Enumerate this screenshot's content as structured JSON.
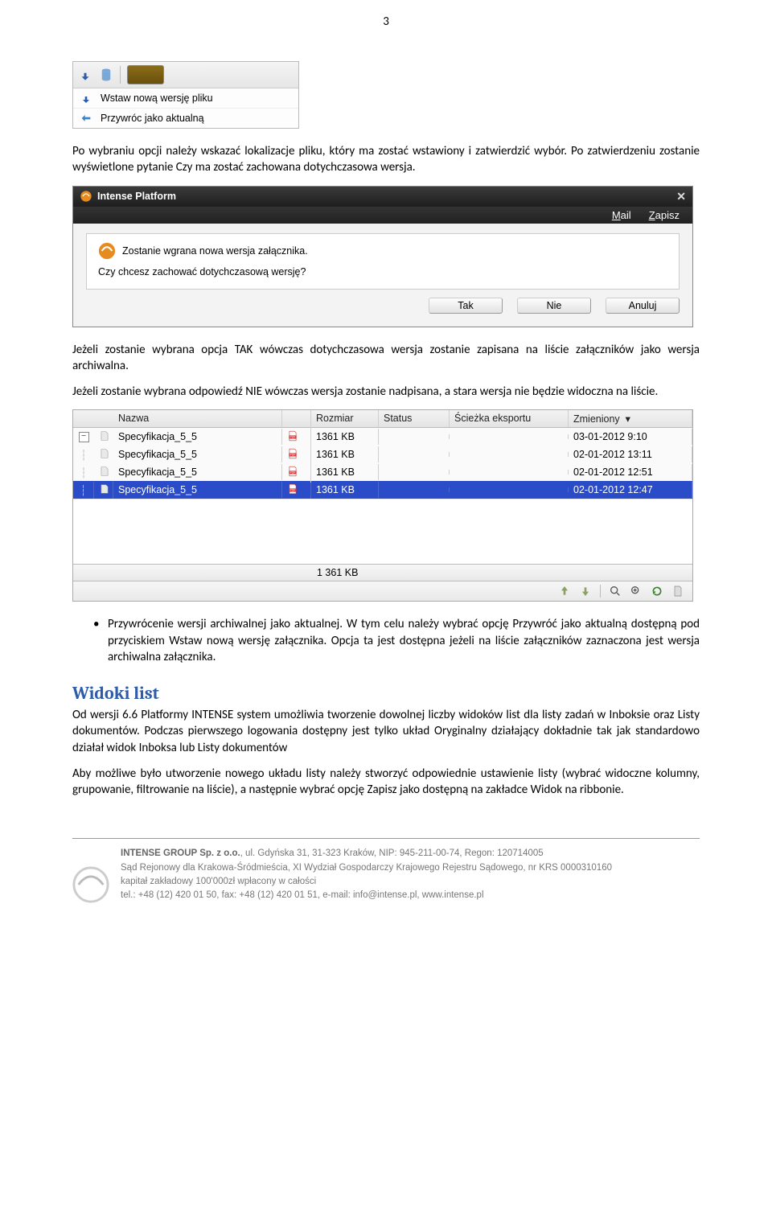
{
  "page_number": "3",
  "menu_shot": {
    "item1": "Wstaw nową wersję pliku",
    "item2": "Przywróc jako aktualną"
  },
  "para1": "Po wybraniu opcji należy wskazać lokalizacje pliku, który ma zostać wstawiony i zatwierdzić wybór. Po zatwierdzeniu zostanie wyświetlone pytanie Czy ma zostać zachowana dotychczasowa wersja.",
  "dialog": {
    "title": "Intense Platform",
    "menu_mail": "Mail",
    "menu_zapisz": "Zapisz",
    "line1": "Zostanie wgrana nowa wersja załącznika.",
    "line2": "Czy chcesz zachować dotychczasową wersję?",
    "btn_tak": "Tak",
    "btn_nie": "Nie",
    "btn_anuluj": "Anuluj"
  },
  "para2": "Jeżeli zostanie wybrana opcja TAK wówczas dotychczasowa wersja zostanie zapisana na liście załączników jako wersja archiwalna.",
  "para3": "Jeżeli zostanie wybrana odpowiedź NIE wówczas wersja zostanie nadpisana, a stara wersja nie będzie widoczna na liście.",
  "list": {
    "header": {
      "nazwa": "Nazwa",
      "rozmiar": "Rozmiar",
      "status": "Status",
      "sciezka": "Ścieżka eksportu",
      "zmieniony": "Zmieniony"
    },
    "rows": [
      {
        "name": "Specyfikacja_5_5",
        "size": "1361 KB",
        "date": "03-01-2012 9:10",
        "sel": false
      },
      {
        "name": "Specyfikacja_5_5",
        "size": "1361 KB",
        "date": "02-01-2012 13:11",
        "sel": false
      },
      {
        "name": "Specyfikacja_5_5",
        "size": "1361 KB",
        "date": "02-01-2012 12:51",
        "sel": false
      },
      {
        "name": "Specyfikacja_5_5",
        "size": "1361 KB",
        "date": "02-01-2012 12:47",
        "sel": true
      }
    ],
    "sum_size": "1 361 KB"
  },
  "bullet": "Przywrócenie wersji archiwalnej jako aktualnej. W tym celu należy wybrać opcję Przywróć jako aktualną dostępną pod przyciskiem Wstaw nową wersję załącznika. Opcja ta jest dostępna jeżeli na liście załączników zaznaczona jest wersja archiwalna załącznika.",
  "heading": "Widoki list",
  "para4": "Od wersji 6.6 Platformy INTENSE system umożliwia tworzenie dowolnej liczby widoków list dla listy zadań w Inboksie oraz Listy dokumentów. Podczas pierwszego logowania dostępny jest tylko układ Oryginalny działający dokładnie tak jak standardowo działał widok Inboksa lub  Listy dokumentów",
  "para5": "Aby możliwe było utworzenie nowego układu listy należy stworzyć odpowiednie ustawienie listy (wybrać widoczne kolumny, grupowanie, filtrowanie na liście), a następnie wybrać opcję Zapisz jako dostępną na zakładce Widok na ribbonie.",
  "footer": {
    "company": "INTENSE GROUP  Sp. z o.o.",
    "addr": ", ul. Gdyńska 31, 31-323 Kraków, NIP: 945-211-00-74, Regon: 120714005",
    "court": "Sąd Rejonowy dla Krakowa-Śródmieścia, XI Wydział Gospodarczy Krajowego Rejestru Sądowego, nr KRS 0000310160",
    "capital": "kapitał zakładowy 100'000zł wpłacony w całości",
    "contact": "tel.: +48 (12) 420 01 50, fax: +48 (12) 420 01 51, e-mail: info@intense.pl, www.intense.pl"
  }
}
